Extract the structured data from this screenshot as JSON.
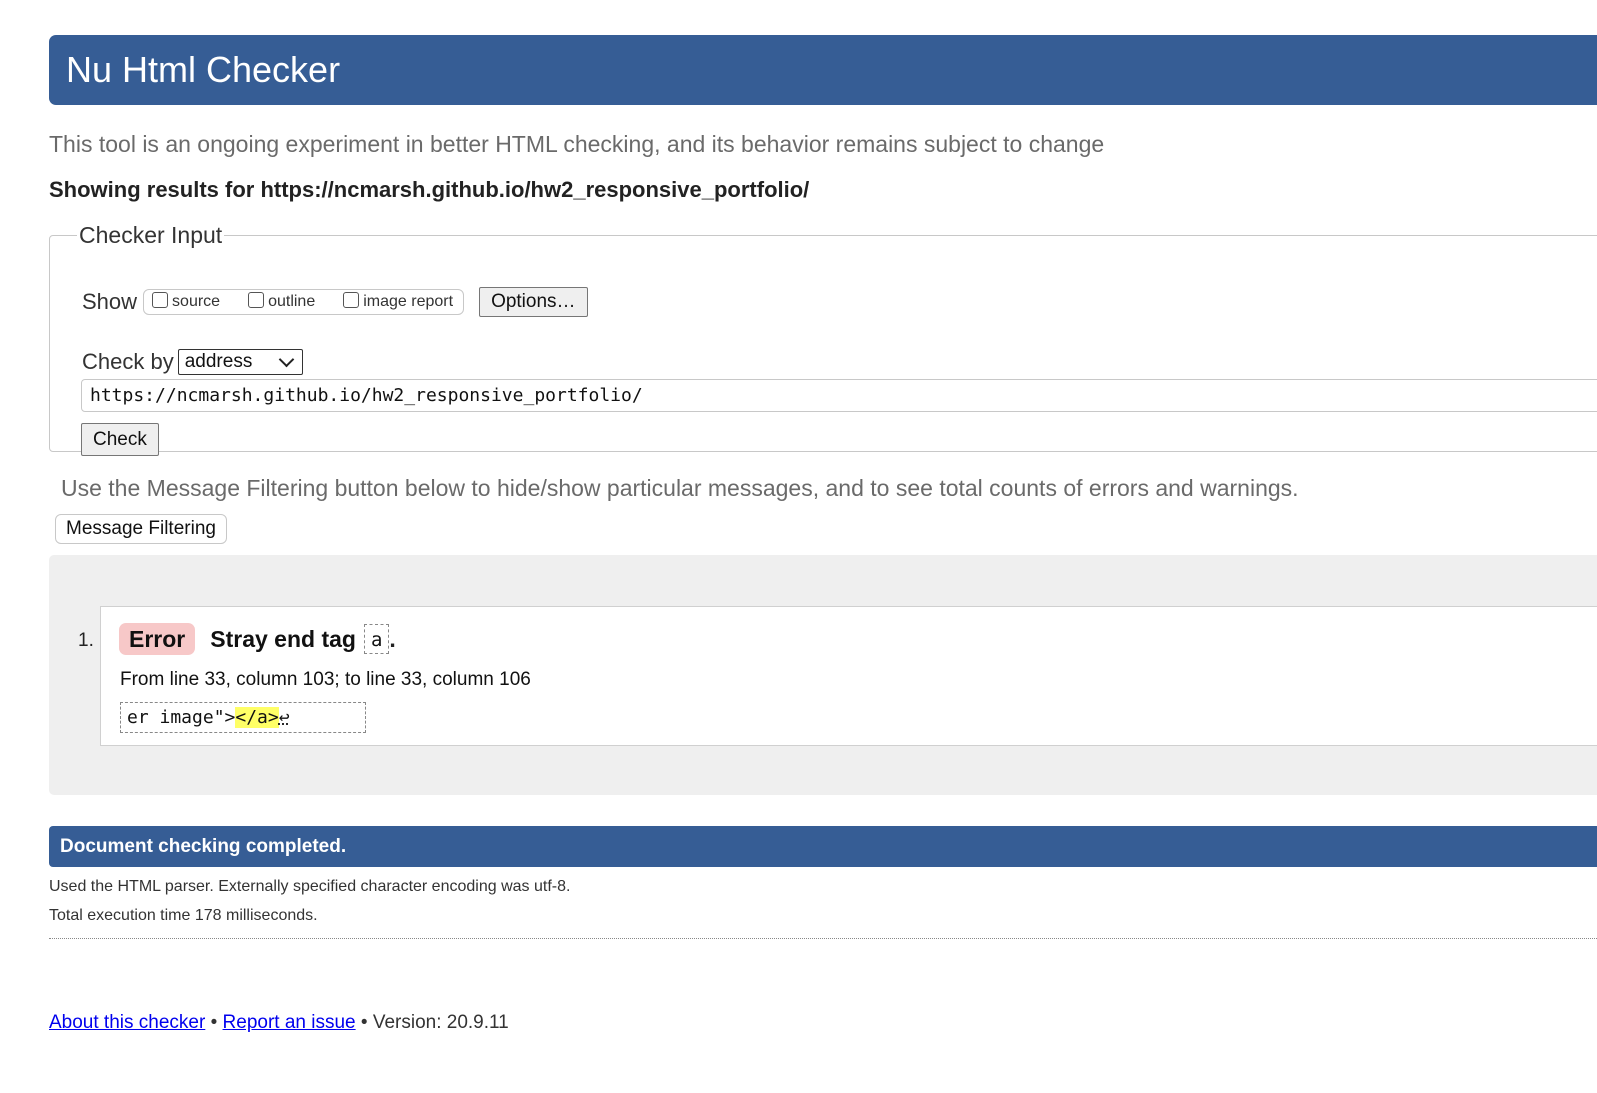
{
  "header": {
    "title": "Nu Html Checker"
  },
  "intro": "This tool is an ongoing experiment in better HTML checking, and its behavior remains subject to change",
  "showing_results": "Showing results for https://ncmarsh.github.io/hw2_responsive_portfolio/",
  "checker_input": {
    "legend": "Checker Input",
    "show_label": "Show",
    "show_options": [
      {
        "label": "source",
        "checked": false
      },
      {
        "label": "outline",
        "checked": false
      },
      {
        "label": "image report",
        "checked": false
      }
    ],
    "options_button": "Options…",
    "check_by_label": "Check by",
    "check_by_selected": "address",
    "url_value": "https://ncmarsh.github.io/hw2_responsive_portfolio/",
    "check_button": "Check"
  },
  "filtering": {
    "text": "Use the Message Filtering button below to hide/show particular messages, and to see total counts of errors and warnings.",
    "button": "Message Filtering"
  },
  "messages": [
    {
      "number": "1.",
      "type": "Error",
      "title": "Stray end tag",
      "code": "a",
      "location": "From line 33, column 103; to line 33, column 106",
      "extract_before": "er image\">",
      "extract_highlight": "</a>",
      "extract_after": "↩"
    }
  ],
  "completion": {
    "banner": "Document checking completed.",
    "parser_info": "Used the HTML parser. Externally specified character encoding was utf-8.",
    "execution_time": "Total execution time 178 milliseconds."
  },
  "footer": {
    "about_link": "About this checker",
    "separator": "•",
    "report_link": "Report an issue",
    "version": "Version: 20.9.11"
  },
  "colors": {
    "brand_blue": "#365d95",
    "error_badge": "#f7c8c8",
    "highlight": "#ffff66",
    "link": "#0000ee"
  }
}
